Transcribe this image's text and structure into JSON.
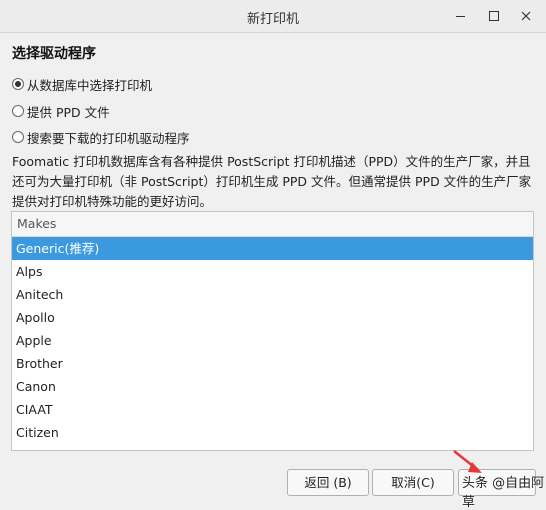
{
  "window": {
    "title": "新打印机",
    "minimize_icon": "minimize-icon",
    "maximize_icon": "maximize-icon",
    "close_icon": "close-icon"
  },
  "page": {
    "heading": "选择驱动程序",
    "options": [
      {
        "label": "从数据库中选择打印机",
        "selected": true
      },
      {
        "label": "提供 PPD 文件",
        "selected": false
      },
      {
        "label": "搜索要下载的打印机驱动程序",
        "selected": false
      }
    ],
    "description": "Foomatic 打印机数据库含有各种提供 PostScript 打印机描述（PPD）文件的生产厂家，并且还可为大量打印机（非 PostScript）打印机生成 PPD 文件。但通常提供 PPD 文件的生产厂家提供对打印机特殊功能的更好访问。"
  },
  "makes_list": {
    "header": "Makes",
    "items": [
      {
        "label": "Generic(推荐)",
        "selected": true
      },
      {
        "label": "Alps",
        "selected": false
      },
      {
        "label": "Anitech",
        "selected": false
      },
      {
        "label": "Apollo",
        "selected": false
      },
      {
        "label": "Apple",
        "selected": false
      },
      {
        "label": "Brother",
        "selected": false
      },
      {
        "label": "Canon",
        "selected": false
      },
      {
        "label": "CIAAT",
        "selected": false
      },
      {
        "label": "Citizen",
        "selected": false
      }
    ],
    "selected_color": "#3b99e0"
  },
  "buttons": {
    "back": "返回 (B)",
    "cancel": "取消(C)",
    "forward": ""
  },
  "watermark": {
    "text": "头条 @自由阿草",
    "arrow_color": "#e53935"
  }
}
